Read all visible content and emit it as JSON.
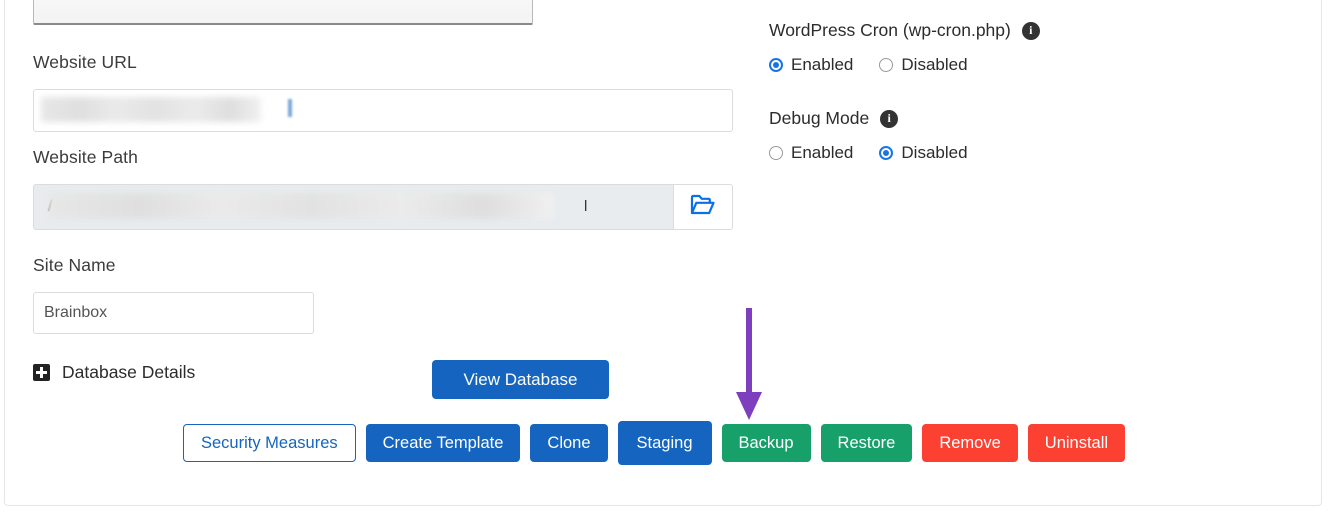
{
  "page": {
    "background": "#ffffff",
    "card_border_color": "#e6e6e6"
  },
  "left": {
    "website_url": {
      "label": "Website URL",
      "value": "",
      "redacted": true
    },
    "website_path": {
      "label": "Website Path",
      "value_prefix": "/",
      "value_suffix": "l",
      "redacted": true,
      "browse_icon": "open-folder-icon"
    },
    "site_name": {
      "label": "Site Name",
      "value": "Brainbox"
    },
    "database_details": {
      "label": "Database Details",
      "toggle_icon": "plus-square-icon",
      "expanded": false
    },
    "view_database_button": "View Database"
  },
  "right": {
    "wp_cron": {
      "title": "WordPress Cron (wp-cron.php)",
      "info_icon": "info-icon",
      "options": [
        "Enabled",
        "Disabled"
      ],
      "selected": "Enabled"
    },
    "debug_mode": {
      "title": "Debug Mode",
      "info_icon": "info-icon",
      "options": [
        "Enabled",
        "Disabled"
      ],
      "selected": "Disabled"
    }
  },
  "actions": [
    {
      "label": "Security Measures",
      "style": "outline",
      "color": "#1565c0",
      "highlighted": false
    },
    {
      "label": "Create Template",
      "style": "primary",
      "color": "#1565c0",
      "highlighted": false
    },
    {
      "label": "Clone",
      "style": "primary",
      "color": "#1565c0",
      "highlighted": false
    },
    {
      "label": "Staging",
      "style": "primary",
      "color": "#1565c0",
      "highlighted": true
    },
    {
      "label": "Backup",
      "style": "green",
      "color": "#18a06a",
      "highlighted": false
    },
    {
      "label": "Restore",
      "style": "green",
      "color": "#18a06a",
      "highlighted": false
    },
    {
      "label": "Remove",
      "style": "red",
      "color": "#fc4032",
      "highlighted": false
    },
    {
      "label": "Uninstall",
      "style": "red",
      "color": "#fc4032",
      "highlighted": false
    }
  ],
  "annotation": {
    "type": "arrow",
    "direction": "down",
    "color": "#7e3fbf",
    "points_to": "Staging"
  }
}
